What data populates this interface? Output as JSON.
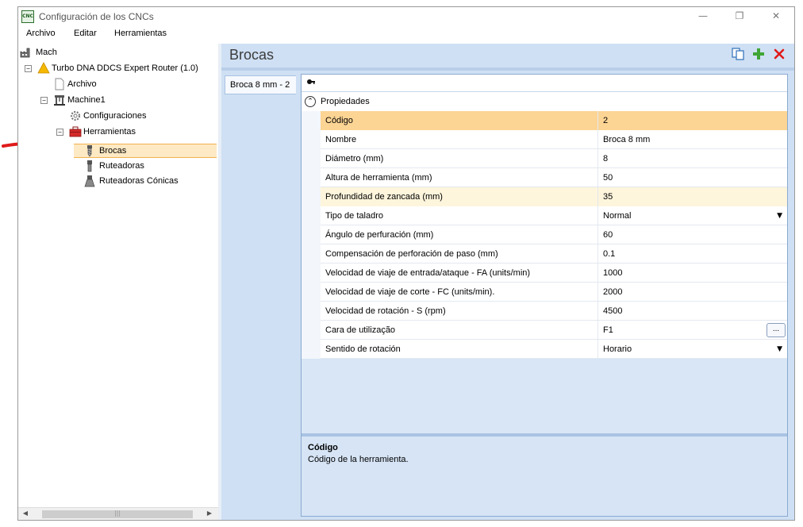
{
  "window": {
    "title": "Configuración de los CNCs",
    "app_icon": "CNC",
    "minimize_glyph": "—",
    "restore_glyph": "❐",
    "close_glyph": "✕"
  },
  "menu": [
    "Archivo",
    "Editar",
    "Herramientas"
  ],
  "tree": {
    "root": "Mach",
    "machine_group": "Turbo DNA DDCS Expert Router (1.0)",
    "archivo": "Archivo",
    "machine": "Machine1",
    "configuraciones": "Configuraciones",
    "herramientas": "Herramientas",
    "brocas": "Brocas",
    "ruteadoras": "Ruteadoras",
    "ruteadoras_conicas": "Ruteadoras Cónicas",
    "collapse_glyph": "−"
  },
  "scrollbar": {
    "left": "◀",
    "right": "▶",
    "grip": "|||"
  },
  "section": {
    "title": "Brocas",
    "icons": [
      "copy-icon",
      "add-icon",
      "delete-icon"
    ]
  },
  "tabs": [
    "Broca 8 mm - 2"
  ],
  "property_grid": {
    "category": "Propiedades",
    "rows": [
      {
        "name": "Código",
        "value": "2",
        "state": "selected"
      },
      {
        "name": "Nombre",
        "value": "Broca 8 mm"
      },
      {
        "name": "Diámetro (mm)",
        "value": "8"
      },
      {
        "name": "Altura de herramienta (mm)",
        "value": "50"
      },
      {
        "name": "Profundidad de zancada (mm)",
        "value": "35",
        "state": "modified"
      },
      {
        "name": "Tipo de taladro",
        "value": "Normal",
        "editor": "dropdown"
      },
      {
        "name": "Ángulo de perfuración (mm)",
        "value": "60"
      },
      {
        "name": "Compensación de perforación de paso (mm)",
        "value": "0.1"
      },
      {
        "name": "Velocidad de viaje de entrada/ataque - FA (units/min)",
        "value": "1000"
      },
      {
        "name": "Velocidad de viaje de corte - FC (units/min).",
        "value": "2000"
      },
      {
        "name": "Velocidad de rotación - S (rpm)",
        "value": "4500"
      },
      {
        "name": "Cara de utilização",
        "value": "F1",
        "editor": "ellipsis"
      },
      {
        "name": "Sentido de rotación",
        "value": "Horario",
        "editor": "dropdown"
      }
    ]
  },
  "description": {
    "title": "Código",
    "text": "Código de la herramienta."
  },
  "colors": {
    "selection": "#fcd494",
    "modified": "#fdf5dc",
    "panel": "#cfe0f4",
    "arrow": "#e01b1b"
  }
}
